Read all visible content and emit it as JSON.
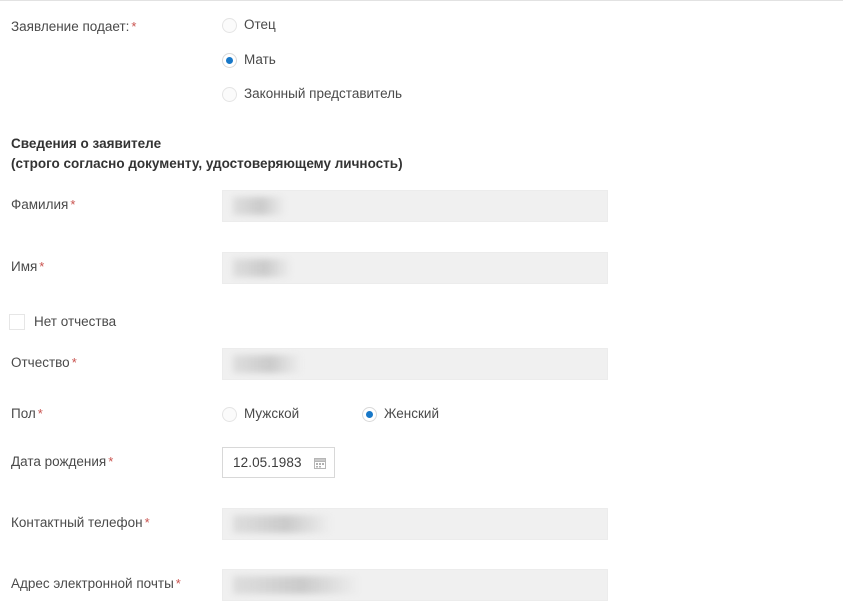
{
  "form": {
    "applicant_question": {
      "label": "Заявление подает:",
      "required_mark": "*",
      "options": [
        {
          "label": "Отец",
          "selected": false
        },
        {
          "label": "Мать",
          "selected": true
        },
        {
          "label": "Законный представитель",
          "selected": false
        }
      ]
    },
    "section_heading": {
      "line1": "Сведения о заявителе",
      "line2": "(строго согласно документу, удостоверяющему личность)"
    },
    "fields": {
      "last_name": {
        "label": "Фамилия",
        "required_mark": "*",
        "value": "",
        "redacted": true
      },
      "first_name": {
        "label": "Имя",
        "required_mark": "*",
        "value": "",
        "redacted": true
      },
      "no_patronymic": {
        "label": "Нет отчества",
        "checked": false
      },
      "patronymic": {
        "label": "Отчество",
        "required_mark": "*",
        "value": "",
        "redacted": true
      },
      "gender": {
        "label": "Пол",
        "required_mark": "*",
        "options": [
          {
            "label": "Мужской",
            "selected": false
          },
          {
            "label": "Женский",
            "selected": true
          }
        ]
      },
      "birth_date": {
        "label": "Дата рождения",
        "required_mark": "*",
        "value": "12.05.1983",
        "icon": "calendar-icon"
      },
      "phone": {
        "label": "Контактный телефон",
        "required_mark": "*",
        "value": "",
        "redacted": true
      },
      "email": {
        "label": "Адрес электронной почты",
        "required_mark": "*",
        "value": "",
        "redacted": true
      }
    }
  },
  "colors": {
    "accent": "#1878c8",
    "required": "#c9524e",
    "field_background": "#f0f0f0",
    "text": "#4a4a4a"
  }
}
